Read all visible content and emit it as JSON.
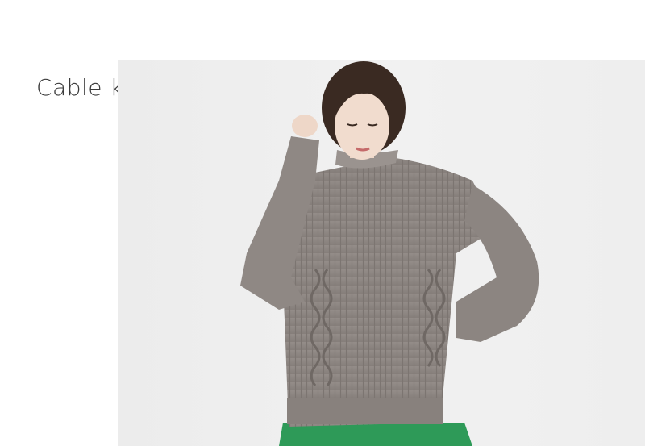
{
  "section": {
    "title": "Cable knit"
  },
  "photo": {
    "icon": "model-photo",
    "colors": {
      "background": "#eeeeee",
      "sweater": "#8f8884",
      "skirt": "#2e9a58",
      "hair": "#3a2a22",
      "skin": "#eed7c8"
    }
  }
}
